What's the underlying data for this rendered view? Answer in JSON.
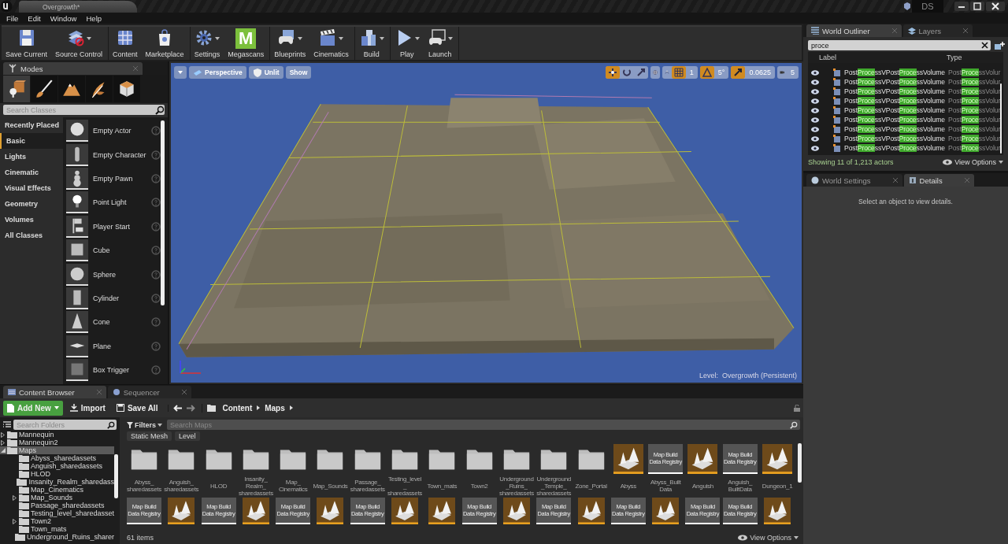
{
  "title_bar": {
    "document_tab": "Overgrowth*",
    "user": "DS"
  },
  "menu": [
    "File",
    "Edit",
    "Window",
    "Help"
  ],
  "toolbar": [
    {
      "label": "Save Current",
      "dropdown": false
    },
    {
      "label": "Source Control",
      "dropdown": true
    },
    {
      "label": "Content",
      "dropdown": false
    },
    {
      "label": "Marketplace",
      "dropdown": false
    },
    {
      "label": "Settings",
      "dropdown": true
    },
    {
      "label": "Megascans",
      "dropdown": false,
      "badge": "M"
    },
    {
      "label": "Blueprints",
      "dropdown": true
    },
    {
      "label": "Cinematics",
      "dropdown": true
    },
    {
      "label": "Build",
      "dropdown": true
    },
    {
      "label": "Play",
      "dropdown": true
    },
    {
      "label": "Launch",
      "dropdown": true
    }
  ],
  "modes": {
    "title": "Modes",
    "tabs": [
      {
        "selected": true
      },
      {
        "selected": false
      },
      {
        "selected": false
      },
      {
        "selected": false
      },
      {
        "selected": false
      }
    ],
    "search": {
      "placeholder": "Search Classes"
    },
    "categories": [
      {
        "label": "Recently Placed",
        "selected": false
      },
      {
        "label": "Basic",
        "selected": true
      },
      {
        "label": "Lights",
        "selected": false
      },
      {
        "label": "Cinematic",
        "selected": false
      },
      {
        "label": "Visual Effects",
        "selected": false
      },
      {
        "label": "Geometry",
        "selected": false
      },
      {
        "label": "Volumes",
        "selected": false
      },
      {
        "label": "All Classes",
        "selected": false
      }
    ],
    "items": [
      "Empty Actor",
      "Empty Character",
      "Empty Pawn",
      "Point Light",
      "Player Start",
      "Cube",
      "Sphere",
      "Cylinder",
      "Cone",
      "Plane",
      "Box Trigger"
    ]
  },
  "viewport": {
    "buttons": [
      "Perspective",
      "Unlit",
      "Show"
    ],
    "transform_modes": [
      {
        "selected": true
      },
      {
        "selected": false
      },
      {
        "selected": false
      }
    ],
    "snaps": [
      {
        "value": "1",
        "on": true
      },
      {
        "value": "5°",
        "on": true
      },
      {
        "value": "0.0625",
        "on": true
      }
    ],
    "camera_speed": "5",
    "level_label": "Level:  Overgrowth (Persistent)"
  },
  "outliner": {
    "tabs": [
      {
        "label": "World Outliner",
        "selected": true
      },
      {
        "label": "Layers",
        "selected": false
      }
    ],
    "search": {
      "value": "proce"
    },
    "columns": [
      "Label",
      "Type"
    ],
    "rows": [
      {
        "label_parts": [
          {
            "text": "Post",
            "match": false
          },
          {
            "text": "Proce",
            "match": true
          },
          {
            "text": "ssVPost",
            "match": false
          },
          {
            "text": "Proce",
            "match": true
          },
          {
            "text": "ssVolume",
            "match": false
          }
        ],
        "type_parts": [
          {
            "text": "Post",
            "match": false
          },
          {
            "text": "Proce",
            "match": true
          },
          {
            "text": "ssVolur",
            "match": false
          }
        ]
      },
      {
        "label_parts": [
          {
            "text": "Post",
            "match": false
          },
          {
            "text": "Proce",
            "match": true
          },
          {
            "text": "ssVPost",
            "match": false
          },
          {
            "text": "Proce",
            "match": true
          },
          {
            "text": "ssVolume",
            "match": false
          }
        ],
        "type_parts": [
          {
            "text": "Post",
            "match": false
          },
          {
            "text": "Proce",
            "match": true
          },
          {
            "text": "ssVolur",
            "match": false
          }
        ]
      },
      {
        "label_parts": [
          {
            "text": "Post",
            "match": false
          },
          {
            "text": "Proce",
            "match": true
          },
          {
            "text": "ssVPost",
            "match": false
          },
          {
            "text": "Proce",
            "match": true
          },
          {
            "text": "ssVolume",
            "match": false
          }
        ],
        "type_parts": [
          {
            "text": "Post",
            "match": false
          },
          {
            "text": "Proce",
            "match": true
          },
          {
            "text": "ssVolur",
            "match": false
          }
        ]
      },
      {
        "label_parts": [
          {
            "text": "Post",
            "match": false
          },
          {
            "text": "Proce",
            "match": true
          },
          {
            "text": "ssVPost",
            "match": false
          },
          {
            "text": "Proce",
            "match": true
          },
          {
            "text": "ssVolume",
            "match": false
          }
        ],
        "type_parts": [
          {
            "text": "Post",
            "match": false
          },
          {
            "text": "Proce",
            "match": true
          },
          {
            "text": "ssVolur",
            "match": false
          }
        ]
      },
      {
        "label_parts": [
          {
            "text": "Post",
            "match": false
          },
          {
            "text": "Proce",
            "match": true
          },
          {
            "text": "ssVPost",
            "match": false
          },
          {
            "text": "Proce",
            "match": true
          },
          {
            "text": "ssVolume",
            "match": false
          }
        ],
        "type_parts": [
          {
            "text": "Post",
            "match": false
          },
          {
            "text": "Proce",
            "match": true
          },
          {
            "text": "ssVolur",
            "match": false
          }
        ]
      },
      {
        "label_parts": [
          {
            "text": "Post",
            "match": false
          },
          {
            "text": "Proce",
            "match": true
          },
          {
            "text": "ssVPost",
            "match": false
          },
          {
            "text": "Proce",
            "match": true
          },
          {
            "text": "ssVolume",
            "match": false
          }
        ],
        "type_parts": [
          {
            "text": "Post",
            "match": false
          },
          {
            "text": "Proce",
            "match": true
          },
          {
            "text": "ssVolur",
            "match": false
          }
        ]
      },
      {
        "label_parts": [
          {
            "text": "Post",
            "match": false
          },
          {
            "text": "Proce",
            "match": true
          },
          {
            "text": "ssVPost",
            "match": false
          },
          {
            "text": "Proce",
            "match": true
          },
          {
            "text": "ssVolume",
            "match": false
          }
        ],
        "type_parts": [
          {
            "text": "Post",
            "match": false
          },
          {
            "text": "Proce",
            "match": true
          },
          {
            "text": "ssVolur",
            "match": false
          }
        ]
      },
      {
        "label_parts": [
          {
            "text": "Post",
            "match": false
          },
          {
            "text": "Proce",
            "match": true
          },
          {
            "text": "ssVPost",
            "match": false
          },
          {
            "text": "Proce",
            "match": true
          },
          {
            "text": "ssVolume",
            "match": false
          }
        ],
        "type_parts": [
          {
            "text": "Post",
            "match": false
          },
          {
            "text": "Proce",
            "match": true
          },
          {
            "text": "ssVolur",
            "match": false
          }
        ]
      },
      {
        "label_parts": [
          {
            "text": "Post",
            "match": false
          },
          {
            "text": "Proce",
            "match": true
          },
          {
            "text": "ssVPost",
            "match": false
          },
          {
            "text": "Proce",
            "match": true
          },
          {
            "text": "ssVolume",
            "match": false
          }
        ],
        "type_parts": [
          {
            "text": "Post",
            "match": false
          },
          {
            "text": "Proce",
            "match": true
          },
          {
            "text": "ssVolur",
            "match": false
          }
        ]
      }
    ],
    "status": "Showing 11 of 1,213 actors",
    "view_options": "View Options"
  },
  "details": {
    "tabs": [
      {
        "label": "World Settings",
        "selected": false
      },
      {
        "label": "Details",
        "selected": true
      }
    ],
    "message": "Select an object to view details."
  },
  "content_browser": {
    "tabs": [
      {
        "label": "Content Browser",
        "selected": true
      },
      {
        "label": "Sequencer",
        "selected": false
      }
    ],
    "buttons": [
      {
        "label": "Add New",
        "kind": "add"
      },
      {
        "label": "Import",
        "kind": "import"
      },
      {
        "label": "Save All",
        "kind": "save"
      }
    ],
    "path": [
      "Content",
      "Maps"
    ],
    "folder_search": {
      "placeholder": "Search Folders"
    },
    "folders": [
      {
        "name": "Mannequin",
        "kind": "parent",
        "expanded": false,
        "selected": false
      },
      {
        "name": "Mannequin2",
        "kind": "parent",
        "expanded": false,
        "selected": false
      },
      {
        "name": "Maps",
        "kind": "parent",
        "expanded": true,
        "selected": true,
        "children": [
          {
            "name": "Abyss_sharedassets",
            "kind": "leaf",
            "selected": false
          },
          {
            "name": "Anguish_sharedassets",
            "kind": "leaf",
            "selected": false
          },
          {
            "name": "HLOD",
            "kind": "leaf",
            "selected": false
          },
          {
            "name": "Insanity_Realm_sharedass",
            "kind": "leaf",
            "selected": false
          },
          {
            "name": "Map_Cinematics",
            "kind": "leaf",
            "selected": false
          },
          {
            "name": "Map_Sounds",
            "kind": "parent",
            "expanded": false,
            "selected": false
          },
          {
            "name": "Passage_sharedassets",
            "kind": "leaf",
            "selected": false
          },
          {
            "name": "Testing_level_sharedasset",
            "kind": "leaf",
            "selected": false
          },
          {
            "name": "Town2",
            "kind": "parent",
            "expanded": false,
            "selected": false
          },
          {
            "name": "Town_mats",
            "kind": "leaf",
            "selected": false
          },
          {
            "name": "Underground_Ruins_sharer",
            "kind": "leaf",
            "selected": false
          }
        ]
      }
    ],
    "filters": "Filters",
    "asset_search": {
      "placeholder": "Search Maps"
    },
    "filter_chips": [
      "Static Mesh",
      "Level"
    ],
    "assets": [
      {
        "kind": "folder",
        "name": "Abyss_\nsharedassets"
      },
      {
        "kind": "folder",
        "name": "Anguish_\nsharedassets"
      },
      {
        "kind": "folder",
        "name": "HLOD"
      },
      {
        "kind": "folder",
        "name": "Insanity_\nRealm_\nsharedassets"
      },
      {
        "kind": "folder",
        "name": "Map_\nCinematics"
      },
      {
        "kind": "folder",
        "name": "Map_Sounds"
      },
      {
        "kind": "folder",
        "name": "Passage_\nsharedassets"
      },
      {
        "kind": "folder",
        "name": "Testing_level\n_\nsharedassets"
      },
      {
        "kind": "folder",
        "name": "Town_mats"
      },
      {
        "kind": "folder",
        "name": "Town2"
      },
      {
        "kind": "folder",
        "name": "Underground\n_Ruins_\nsharedassets"
      },
      {
        "kind": "folder",
        "name": "Underground\n_Temple_\nsharedassets"
      },
      {
        "kind": "folder",
        "name": "Zone_Portal"
      },
      {
        "kind": "map",
        "name": "Abyss"
      },
      {
        "kind": "registry",
        "name": "Abyss_Built\nData",
        "thumb_text": "Map Build\nData Registry"
      },
      {
        "kind": "map",
        "name": "Anguish"
      },
      {
        "kind": "registry",
        "name": "Anguish_\nBuiltData",
        "thumb_text": "Map Build\nData Registry"
      },
      {
        "kind": "map",
        "name": "Dungeon_1"
      }
    ],
    "assets_row2": [
      {
        "kind": "registry",
        "thumb_text": "Map Build\nData Registry"
      },
      {
        "kind": "map"
      },
      {
        "kind": "registry",
        "thumb_text": "Map Build\nData Registry"
      },
      {
        "kind": "map"
      },
      {
        "kind": "registry",
        "thumb_text": "Map Build\nData Registry"
      },
      {
        "kind": "map"
      },
      {
        "kind": "registry",
        "thumb_text": "Map Build\nData Registry"
      },
      {
        "kind": "map"
      },
      {
        "kind": "map"
      },
      {
        "kind": "registry",
        "thumb_text": "Map Build\nData Registry"
      },
      {
        "kind": "map"
      },
      {
        "kind": "registry",
        "thumb_text": "Map Build\nData Registry"
      },
      {
        "kind": "map"
      },
      {
        "kind": "registry",
        "thumb_text": "Map Build\nData Registry"
      },
      {
        "kind": "map"
      },
      {
        "kind": "registry",
        "thumb_text": "Map Build\nData Registry"
      },
      {
        "kind": "registry",
        "thumb_text": "Map Build\nData Registry"
      },
      {
        "kind": "map"
      }
    ],
    "item_count": "61 items",
    "view_options": "View Options"
  }
}
